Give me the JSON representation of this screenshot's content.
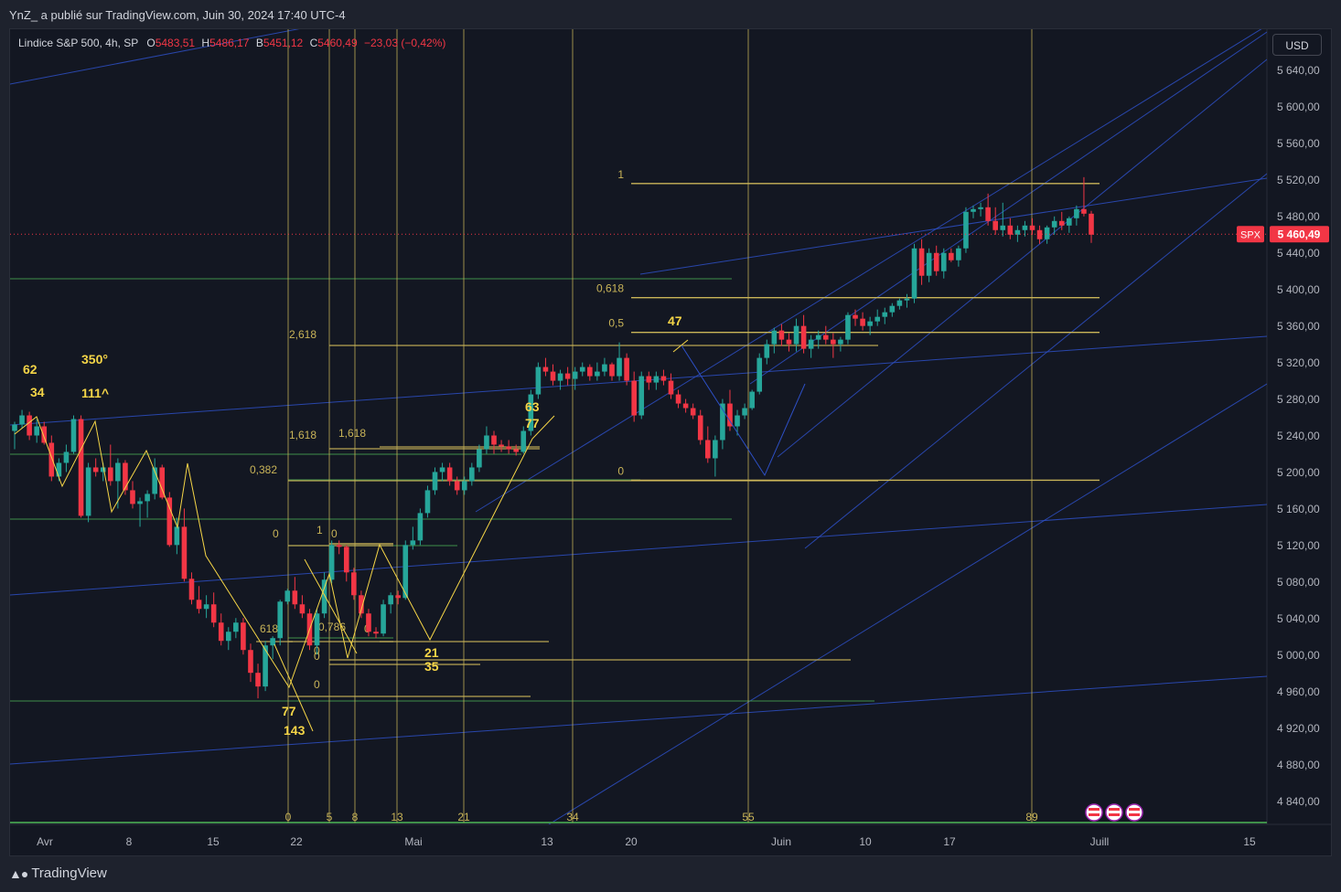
{
  "header": {
    "publisher": "YnZ_ a publié sur TradingView.com, Juin 30, 2024 17:40 UTC-4"
  },
  "legend": {
    "symbol": "Lindice S&P 500, 4h, SP",
    "o_label": "O",
    "o_value": "5483,51",
    "h_label": "H",
    "h_value": "5486,17",
    "b_label": "B",
    "b_value": "5451,12",
    "c_label": "C",
    "c_value": "5460,49",
    "change": "−23,03 (−0,42%)"
  },
  "currency_button": "USD",
  "price_tag": {
    "symbol": "SPX",
    "value": "5 460,49",
    "color": "#f23645"
  },
  "footer": {
    "brand": "TradingView",
    "logo_icon": "tradingview-logo-icon"
  },
  "colors": {
    "up": "#26a69a",
    "down": "#f23645",
    "fib": "#c9b458",
    "channel": "#2d4fc4",
    "green_line": "#3f8f4a",
    "wave": "#f5d547"
  },
  "chart_data": {
    "type": "candlestick",
    "ylim": [
      4810,
      5680
    ],
    "y_ticks": [
      "5 640,00",
      "5 600,00",
      "5 560,00",
      "5 520,00",
      "5 480,00",
      "5 440,00",
      "5 400,00",
      "5 360,00",
      "5 320,00",
      "5 280,00",
      "5 240,00",
      "5 200,00",
      "5 160,00",
      "5 120,00",
      "5 080,00",
      "5 040,00",
      "5 000,00",
      "4 960,00",
      "4 920,00",
      "4 880,00",
      "4 840,00"
    ],
    "x_ticks": [
      "Avr",
      "8",
      "15",
      "22",
      "Mai",
      "13",
      "20",
      "Juin",
      "10",
      "17",
      "Juill",
      "15"
    ],
    "last_price": 5460.49,
    "fib_time_labels": [
      "0",
      "5",
      "8",
      "13",
      "21",
      "34",
      "55",
      "89"
    ],
    "fib_levels_main": [
      {
        "label": "1",
        "price": 5516
      },
      {
        "label": "0,618",
        "price": 5391
      },
      {
        "label": "0,5",
        "price": 5353
      },
      {
        "label": "0",
        "price": 5191
      }
    ],
    "fib_levels_secondary": [
      {
        "label": "2,618",
        "price": 5338
      },
      {
        "label": "1,618",
        "price": 5227
      },
      {
        "label": "1,618",
        "price": 5231
      },
      {
        "label": "0,382",
        "price": 5191
      },
      {
        "label": "1",
        "price": 5122
      },
      {
        "label": "0",
        "price": 5122
      },
      {
        "label": "0",
        "price": 5122
      },
      {
        "label": "0",
        "price": 5016
      },
      {
        "label": "0",
        "price": 5003
      },
      {
        "label": "0",
        "price": 4997
      },
      {
        "label": "0",
        "price": 4967
      },
      {
        "label": "0,786",
        "price": 5029
      },
      {
        "label": "618",
        "price": 5029
      }
    ],
    "wave_labels": [
      "62",
      "34",
      "350°",
      "111^",
      "77",
      "143",
      "63",
      "77",
      "21",
      "35",
      "47"
    ],
    "candles": [
      [
        5245,
        5255,
        5225,
        5252
      ],
      [
        5252,
        5268,
        5248,
        5262
      ],
      [
        5262,
        5266,
        5235,
        5240
      ],
      [
        5240,
        5258,
        5232,
        5250
      ],
      [
        5250,
        5255,
        5230,
        5232
      ],
      [
        5232,
        5240,
        5190,
        5195
      ],
      [
        5195,
        5215,
        5190,
        5210
      ],
      [
        5210,
        5230,
        5200,
        5222
      ],
      [
        5222,
        5262,
        5220,
        5258
      ],
      [
        5258,
        5262,
        5150,
        5152
      ],
      [
        5152,
        5210,
        5145,
        5205
      ],
      [
        5205,
        5215,
        5195,
        5200
      ],
      [
        5200,
        5210,
        5190,
        5205
      ],
      [
        5205,
        5230,
        5185,
        5190
      ],
      [
        5190,
        5215,
        5160,
        5210
      ],
      [
        5210,
        5213,
        5175,
        5180
      ],
      [
        5180,
        5190,
        5160,
        5165
      ],
      [
        5165,
        5172,
        5140,
        5168
      ],
      [
        5168,
        5180,
        5150,
        5176
      ],
      [
        5176,
        5215,
        5170,
        5205
      ],
      [
        5205,
        5208,
        5170,
        5172
      ],
      [
        5172,
        5178,
        5118,
        5120
      ],
      [
        5120,
        5150,
        5110,
        5140
      ],
      [
        5140,
        5160,
        5080,
        5083
      ],
      [
        5083,
        5090,
        5055,
        5060
      ],
      [
        5060,
        5075,
        5045,
        5050
      ],
      [
        5050,
        5065,
        5040,
        5055
      ],
      [
        5055,
        5068,
        5030,
        5035
      ],
      [
        5035,
        5045,
        5010,
        5015
      ],
      [
        5015,
        5030,
        5005,
        5025
      ],
      [
        5025,
        5040,
        5018,
        5035
      ],
      [
        5035,
        5040,
        5000,
        5005
      ],
      [
        5005,
        5012,
        4970,
        4980
      ],
      [
        4980,
        4990,
        4952,
        4965
      ],
      [
        4965,
        5015,
        4960,
        5010
      ],
      [
        5010,
        5020,
        4995,
        5018
      ],
      [
        5018,
        5060,
        5010,
        5058
      ],
      [
        5058,
        5072,
        5055,
        5070
      ],
      [
        5070,
        5085,
        5050,
        5055
      ],
      [
        5055,
        5065,
        5040,
        5045
      ],
      [
        5045,
        5050,
        5005,
        5010
      ],
      [
        5010,
        5050,
        5000,
        5045
      ],
      [
        5045,
        5090,
        5040,
        5082
      ],
      [
        5082,
        5125,
        5078,
        5120
      ],
      [
        5120,
        5125,
        5110,
        5118
      ],
      [
        5118,
        5120,
        5080,
        5090
      ],
      [
        5090,
        5095,
        5060,
        5065
      ],
      [
        5065,
        5070,
        5040,
        5045
      ],
      [
        5045,
        5050,
        5020,
        5025
      ],
      [
        5025,
        5030,
        5018,
        5023
      ],
      [
        5023,
        5060,
        5020,
        5055
      ],
      [
        5055,
        5068,
        5045,
        5065
      ],
      [
        5065,
        5070,
        5055,
        5062
      ],
      [
        5062,
        5125,
        5060,
        5120
      ],
      [
        5120,
        5140,
        5115,
        5125
      ],
      [
        5125,
        5160,
        5120,
        5155
      ],
      [
        5155,
        5185,
        5150,
        5180
      ],
      [
        5180,
        5205,
        5175,
        5200
      ],
      [
        5200,
        5210,
        5190,
        5205
      ],
      [
        5205,
        5210,
        5185,
        5190
      ],
      [
        5190,
        5195,
        5175,
        5180
      ],
      [
        5180,
        5195,
        5175,
        5190
      ],
      [
        5190,
        5210,
        5185,
        5205
      ],
      [
        5205,
        5230,
        5200,
        5225
      ],
      [
        5225,
        5250,
        5220,
        5240
      ],
      [
        5240,
        5245,
        5220,
        5230
      ],
      [
        5230,
        5235,
        5222,
        5228
      ],
      [
        5228,
        5235,
        5220,
        5225
      ],
      [
        5225,
        5230,
        5218,
        5222
      ],
      [
        5222,
        5250,
        5220,
        5245
      ],
      [
        5245,
        5290,
        5240,
        5285
      ],
      [
        5285,
        5320,
        5280,
        5315
      ],
      [
        5315,
        5325,
        5305,
        5310
      ],
      [
        5310,
        5318,
        5295,
        5300
      ],
      [
        5300,
        5312,
        5290,
        5308
      ],
      [
        5308,
        5315,
        5295,
        5302
      ],
      [
        5302,
        5315,
        5290,
        5310
      ],
      [
        5310,
        5320,
        5305,
        5315
      ],
      [
        5315,
        5318,
        5300,
        5305
      ],
      [
        5305,
        5320,
        5300,
        5310
      ],
      [
        5310,
        5325,
        5305,
        5318
      ],
      [
        5318,
        5320,
        5300,
        5305
      ],
      [
        5305,
        5342,
        5300,
        5325
      ],
      [
        5325,
        5330,
        5295,
        5300
      ],
      [
        5300,
        5310,
        5255,
        5262
      ],
      [
        5262,
        5310,
        5258,
        5305
      ],
      [
        5305,
        5310,
        5290,
        5298
      ],
      [
        5298,
        5310,
        5290,
        5305
      ],
      [
        5305,
        5312,
        5295,
        5300
      ],
      [
        5300,
        5308,
        5280,
        5285
      ],
      [
        5285,
        5290,
        5270,
        5275
      ],
      [
        5275,
        5280,
        5265,
        5270
      ],
      [
        5270,
        5275,
        5258,
        5262
      ],
      [
        5262,
        5268,
        5230,
        5235
      ],
      [
        5235,
        5250,
        5210,
        5215
      ],
      [
        5215,
        5240,
        5195,
        5235
      ],
      [
        5235,
        5280,
        5225,
        5275
      ],
      [
        5275,
        5290,
        5245,
        5250
      ],
      [
        5250,
        5268,
        5240,
        5262
      ],
      [
        5262,
        5275,
        5258,
        5270
      ],
      [
        5270,
        5290,
        5268,
        5288
      ],
      [
        5288,
        5330,
        5285,
        5325
      ],
      [
        5325,
        5345,
        5318,
        5340
      ],
      [
        5340,
        5358,
        5330,
        5355
      ],
      [
        5355,
        5362,
        5338,
        5345
      ],
      [
        5345,
        5352,
        5332,
        5340
      ],
      [
        5340,
        5368,
        5332,
        5360
      ],
      [
        5360,
        5372,
        5330,
        5335
      ],
      [
        5335,
        5350,
        5325,
        5345
      ],
      [
        5345,
        5355,
        5335,
        5350
      ],
      [
        5350,
        5360,
        5340,
        5345
      ],
      [
        5345,
        5352,
        5325,
        5340
      ],
      [
        5340,
        5348,
        5332,
        5345
      ],
      [
        5345,
        5375,
        5340,
        5372
      ],
      [
        5372,
        5378,
        5360,
        5368
      ],
      [
        5368,
        5375,
        5355,
        5360
      ],
      [
        5360,
        5370,
        5350,
        5365
      ],
      [
        5365,
        5378,
        5360,
        5370
      ],
      [
        5370,
        5380,
        5362,
        5375
      ],
      [
        5375,
        5385,
        5370,
        5382
      ],
      [
        5382,
        5390,
        5378,
        5388
      ],
      [
        5388,
        5395,
        5380,
        5390
      ],
      [
        5390,
        5450,
        5385,
        5445
      ],
      [
        5445,
        5455,
        5405,
        5415
      ],
      [
        5415,
        5445,
        5408,
        5440
      ],
      [
        5440,
        5448,
        5415,
        5420
      ],
      [
        5420,
        5445,
        5412,
        5440
      ],
      [
        5440,
        5445,
        5430,
        5432
      ],
      [
        5432,
        5448,
        5425,
        5445
      ],
      [
        5445,
        5490,
        5440,
        5485
      ],
      [
        5485,
        5492,
        5478,
        5488
      ],
      [
        5488,
        5495,
        5480,
        5490
      ],
      [
        5490,
        5505,
        5470,
        5475
      ],
      [
        5475,
        5490,
        5460,
        5465
      ],
      [
        5465,
        5495,
        5458,
        5470
      ],
      [
        5470,
        5478,
        5455,
        5460
      ],
      [
        5460,
        5470,
        5452,
        5465
      ],
      [
        5465,
        5475,
        5458,
        5470
      ],
      [
        5470,
        5478,
        5460,
        5465
      ],
      [
        5465,
        5470,
        5450,
        5455
      ],
      [
        5455,
        5470,
        5450,
        5468
      ],
      [
        5468,
        5480,
        5460,
        5475
      ],
      [
        5475,
        5485,
        5465,
        5470
      ],
      [
        5470,
        5480,
        5462,
        5478
      ],
      [
        5478,
        5492,
        5470,
        5488
      ],
      [
        5488,
        5523,
        5480,
        5483
      ],
      [
        5483,
        5486,
        5451,
        5460
      ]
    ]
  }
}
